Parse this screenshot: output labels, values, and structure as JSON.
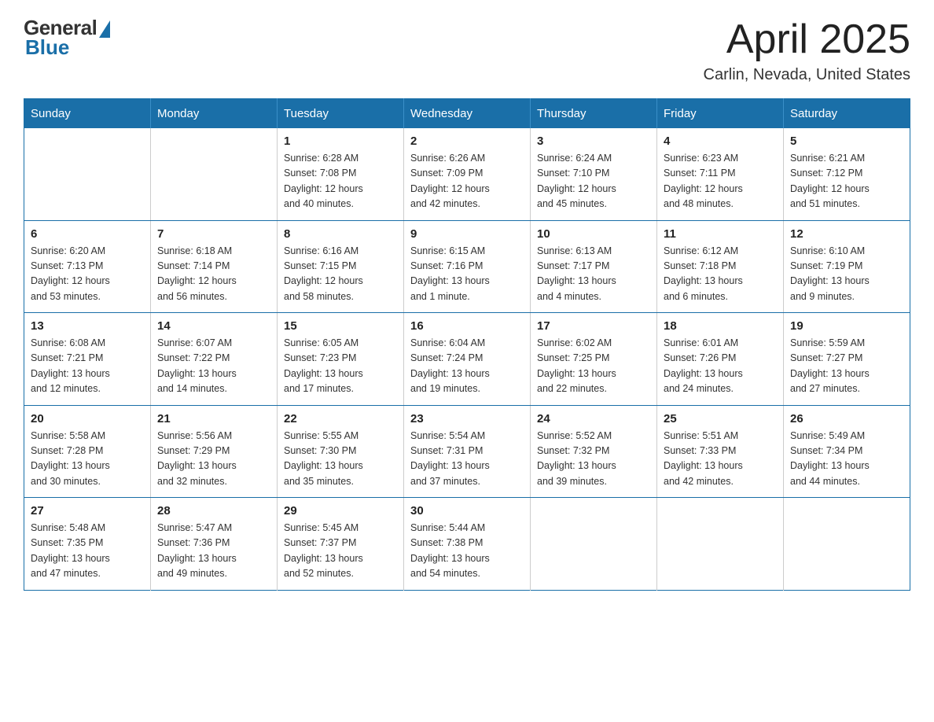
{
  "header": {
    "logo_general": "General",
    "logo_blue": "Blue",
    "month_title": "April 2025",
    "location": "Carlin, Nevada, United States"
  },
  "weekdays": [
    "Sunday",
    "Monday",
    "Tuesday",
    "Wednesday",
    "Thursday",
    "Friday",
    "Saturday"
  ],
  "weeks": [
    [
      {
        "day": "",
        "info": ""
      },
      {
        "day": "",
        "info": ""
      },
      {
        "day": "1",
        "info": "Sunrise: 6:28 AM\nSunset: 7:08 PM\nDaylight: 12 hours\nand 40 minutes."
      },
      {
        "day": "2",
        "info": "Sunrise: 6:26 AM\nSunset: 7:09 PM\nDaylight: 12 hours\nand 42 minutes."
      },
      {
        "day": "3",
        "info": "Sunrise: 6:24 AM\nSunset: 7:10 PM\nDaylight: 12 hours\nand 45 minutes."
      },
      {
        "day": "4",
        "info": "Sunrise: 6:23 AM\nSunset: 7:11 PM\nDaylight: 12 hours\nand 48 minutes."
      },
      {
        "day": "5",
        "info": "Sunrise: 6:21 AM\nSunset: 7:12 PM\nDaylight: 12 hours\nand 51 minutes."
      }
    ],
    [
      {
        "day": "6",
        "info": "Sunrise: 6:20 AM\nSunset: 7:13 PM\nDaylight: 12 hours\nand 53 minutes."
      },
      {
        "day": "7",
        "info": "Sunrise: 6:18 AM\nSunset: 7:14 PM\nDaylight: 12 hours\nand 56 minutes."
      },
      {
        "day": "8",
        "info": "Sunrise: 6:16 AM\nSunset: 7:15 PM\nDaylight: 12 hours\nand 58 minutes."
      },
      {
        "day": "9",
        "info": "Sunrise: 6:15 AM\nSunset: 7:16 PM\nDaylight: 13 hours\nand 1 minute."
      },
      {
        "day": "10",
        "info": "Sunrise: 6:13 AM\nSunset: 7:17 PM\nDaylight: 13 hours\nand 4 minutes."
      },
      {
        "day": "11",
        "info": "Sunrise: 6:12 AM\nSunset: 7:18 PM\nDaylight: 13 hours\nand 6 minutes."
      },
      {
        "day": "12",
        "info": "Sunrise: 6:10 AM\nSunset: 7:19 PM\nDaylight: 13 hours\nand 9 minutes."
      }
    ],
    [
      {
        "day": "13",
        "info": "Sunrise: 6:08 AM\nSunset: 7:21 PM\nDaylight: 13 hours\nand 12 minutes."
      },
      {
        "day": "14",
        "info": "Sunrise: 6:07 AM\nSunset: 7:22 PM\nDaylight: 13 hours\nand 14 minutes."
      },
      {
        "day": "15",
        "info": "Sunrise: 6:05 AM\nSunset: 7:23 PM\nDaylight: 13 hours\nand 17 minutes."
      },
      {
        "day": "16",
        "info": "Sunrise: 6:04 AM\nSunset: 7:24 PM\nDaylight: 13 hours\nand 19 minutes."
      },
      {
        "day": "17",
        "info": "Sunrise: 6:02 AM\nSunset: 7:25 PM\nDaylight: 13 hours\nand 22 minutes."
      },
      {
        "day": "18",
        "info": "Sunrise: 6:01 AM\nSunset: 7:26 PM\nDaylight: 13 hours\nand 24 minutes."
      },
      {
        "day": "19",
        "info": "Sunrise: 5:59 AM\nSunset: 7:27 PM\nDaylight: 13 hours\nand 27 minutes."
      }
    ],
    [
      {
        "day": "20",
        "info": "Sunrise: 5:58 AM\nSunset: 7:28 PM\nDaylight: 13 hours\nand 30 minutes."
      },
      {
        "day": "21",
        "info": "Sunrise: 5:56 AM\nSunset: 7:29 PM\nDaylight: 13 hours\nand 32 minutes."
      },
      {
        "day": "22",
        "info": "Sunrise: 5:55 AM\nSunset: 7:30 PM\nDaylight: 13 hours\nand 35 minutes."
      },
      {
        "day": "23",
        "info": "Sunrise: 5:54 AM\nSunset: 7:31 PM\nDaylight: 13 hours\nand 37 minutes."
      },
      {
        "day": "24",
        "info": "Sunrise: 5:52 AM\nSunset: 7:32 PM\nDaylight: 13 hours\nand 39 minutes."
      },
      {
        "day": "25",
        "info": "Sunrise: 5:51 AM\nSunset: 7:33 PM\nDaylight: 13 hours\nand 42 minutes."
      },
      {
        "day": "26",
        "info": "Sunrise: 5:49 AM\nSunset: 7:34 PM\nDaylight: 13 hours\nand 44 minutes."
      }
    ],
    [
      {
        "day": "27",
        "info": "Sunrise: 5:48 AM\nSunset: 7:35 PM\nDaylight: 13 hours\nand 47 minutes."
      },
      {
        "day": "28",
        "info": "Sunrise: 5:47 AM\nSunset: 7:36 PM\nDaylight: 13 hours\nand 49 minutes."
      },
      {
        "day": "29",
        "info": "Sunrise: 5:45 AM\nSunset: 7:37 PM\nDaylight: 13 hours\nand 52 minutes."
      },
      {
        "day": "30",
        "info": "Sunrise: 5:44 AM\nSunset: 7:38 PM\nDaylight: 13 hours\nand 54 minutes."
      },
      {
        "day": "",
        "info": ""
      },
      {
        "day": "",
        "info": ""
      },
      {
        "day": "",
        "info": ""
      }
    ]
  ]
}
